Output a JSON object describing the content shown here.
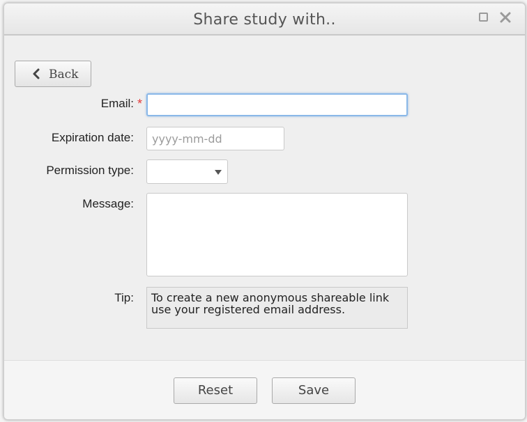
{
  "dialog": {
    "title": "Share study with.."
  },
  "toolbar": {
    "back_label": "Back"
  },
  "form": {
    "email": {
      "label": "Email:",
      "required_mark": "*",
      "value": "",
      "placeholder": ""
    },
    "expiration_date": {
      "label": "Expiration date:",
      "value": "",
      "placeholder": "yyyy-mm-dd"
    },
    "permission_type": {
      "label": "Permission type:",
      "selected": ""
    },
    "message": {
      "label": "Message:",
      "value": ""
    },
    "tip": {
      "label": "Tip:",
      "text": "To create a new anonymous shareable link use your registered email address."
    }
  },
  "footer": {
    "reset_label": "Reset",
    "save_label": "Save"
  },
  "icons": {
    "maximize": "maximize-icon",
    "close": "close-icon",
    "back": "chevron-left-icon",
    "dropdown": "caret-down-icon"
  },
  "colors": {
    "required": "#e23a3a",
    "focus_border": "#8ab8e8"
  }
}
